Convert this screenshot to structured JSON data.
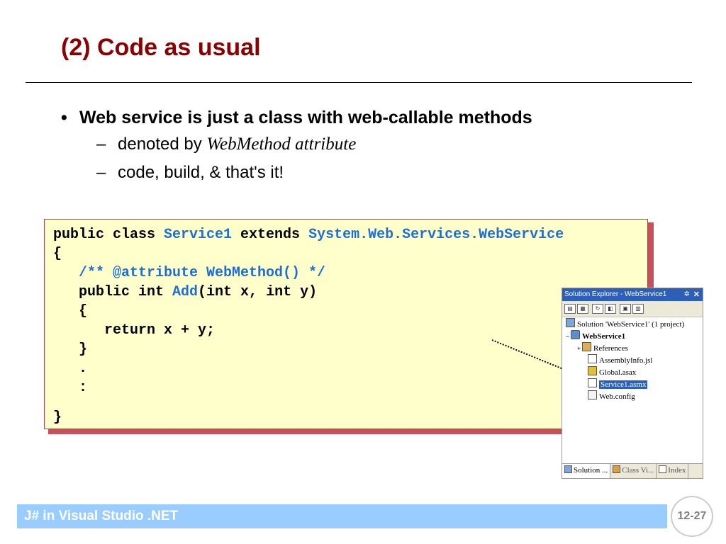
{
  "slide": {
    "title": "(2) Code as usual",
    "bullets": {
      "main": "Web service is just a class with web-callable methods",
      "sub1_prefix": "denoted by ",
      "sub1_italic": "WebMethod attribute",
      "sub2": "code, build, & that's it!"
    },
    "code": {
      "line1_kw1": "public class ",
      "line1_id1": "Service1",
      "line1_kw2": " extends ",
      "line1_id2": "System.Web.Services.WebService",
      "line2": "{",
      "line3": "   /** @attribute WebMethod() */",
      "line4_kw": "   public int ",
      "line4_id": "Add",
      "line4_rest": "(int x, int y)",
      "line5": "   {",
      "line6": "      return x + y;",
      "line7": "   }",
      "line8": "   .",
      "line9": "   :",
      "line10": "}"
    },
    "footer": "J# in Visual Studio .NET",
    "page_number": "12-27"
  },
  "solution_explorer": {
    "title": "Solution Explorer - WebService1",
    "pin": "✲",
    "close": "✕",
    "toolbar_icons": [
      "properties-icon",
      "show-all-icon",
      "refresh-icon",
      "view-code-icon",
      "view-designer-icon",
      "copy-project-icon"
    ],
    "tree": {
      "solution": "Solution 'WebService1' (1 project)",
      "project": "WebService1",
      "references": "References",
      "assemblyinfo": "AssemblyInfo.jsl",
      "global": "Global.asax",
      "service": "Service1.asmx",
      "webconfig": "Web.config"
    },
    "tabs": {
      "solution": "Solution ...",
      "classview": "Class Vi...",
      "index": "Index"
    }
  },
  "colors": {
    "title": "#8b0000",
    "code_background": "#ffffcc",
    "code_identifier": "#1e6ed8",
    "code_shadow": "#c8505a",
    "footer_bar": "#99ccff"
  }
}
